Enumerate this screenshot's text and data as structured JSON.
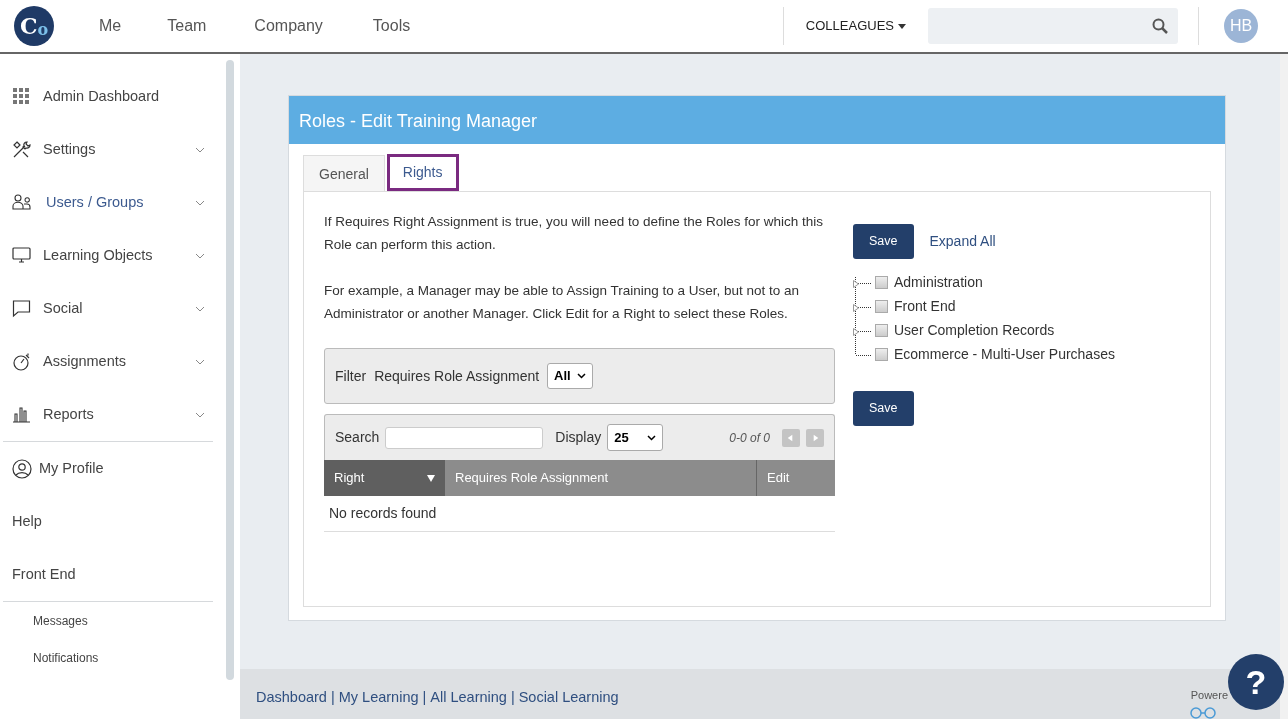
{
  "topbar": {
    "logo_letters": [
      "C",
      "o"
    ],
    "nav": [
      "Me",
      "Team",
      "Company",
      "Tools"
    ],
    "colleagues": "COLLEAGUES",
    "avatar": "HB"
  },
  "sidebar": {
    "sections": [
      {
        "items": [
          {
            "label": "Admin Dashboard",
            "expandable": false,
            "selected": false
          },
          {
            "label": "Settings",
            "expandable": true,
            "selected": false
          },
          {
            "label": "Users / Groups",
            "expandable": true,
            "selected": true
          },
          {
            "label": "Learning Objects",
            "expandable": true,
            "selected": false
          },
          {
            "label": "Social",
            "expandable": true,
            "selected": false
          },
          {
            "label": "Assignments",
            "expandable": true,
            "selected": false
          },
          {
            "label": "Reports",
            "expandable": true,
            "selected": false
          }
        ]
      },
      {
        "items": [
          {
            "label": "My Profile",
            "expandable": false,
            "selected": false
          },
          {
            "label": "Help",
            "expandable": false,
            "selected": false
          },
          {
            "label": "Front End",
            "expandable": false,
            "selected": false
          }
        ]
      },
      {
        "items": [
          {
            "label": "Messages",
            "expandable": false,
            "selected": false
          },
          {
            "label": "Notifications",
            "expandable": false,
            "selected": false
          }
        ]
      }
    ]
  },
  "card": {
    "title": "Roles - Edit Training Manager",
    "tabs": [
      {
        "label": "General",
        "selected": false
      },
      {
        "label": "Rights",
        "selected": true
      }
    ],
    "paragraphs": [
      "If Requires Right Assignment is true, you will need to define the Roles for which this Role can perform this action.",
      "For example, a Manager may be able to Assign Training to a User, but not to an Administrator or another Manager. Click Edit for a Right to select these Roles."
    ],
    "filter": {
      "label": "Filter",
      "field_label": "Requires Role Assignment",
      "value": "All"
    },
    "grid": {
      "search_label": "Search",
      "display_label": "Display",
      "display_value": "25",
      "range": "0-0 of 0",
      "prev_disabled": true,
      "next_disabled": true,
      "columns": [
        {
          "label": "Right",
          "sorted": true
        },
        {
          "label": "Requires Role Assignment",
          "sorted": false
        },
        {
          "label": "Edit",
          "sorted": false
        }
      ],
      "empty": "No records found"
    },
    "save_top": "Save",
    "expand_all": "Expand All",
    "save_bottom": "Save",
    "tree": [
      {
        "label": "Administration",
        "checked": false,
        "has_children": true
      },
      {
        "label": "Front End",
        "checked": false,
        "has_children": true
      },
      {
        "label": "User Completion Records",
        "checked": false,
        "has_children": true
      },
      {
        "label": "Ecommerce - Multi-User Purchases",
        "checked": false,
        "has_children": false
      }
    ]
  },
  "footer": {
    "links": [
      "Dashboard",
      "My Learning",
      "All Learning",
      "Social Learning"
    ],
    "separator": "|",
    "powered": "Powere",
    "help": "?"
  }
}
